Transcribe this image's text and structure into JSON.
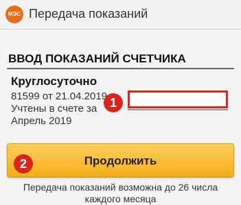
{
  "app": {
    "title": "Передача показаний",
    "logo_text": "МЭС",
    "accent": "#f2ad1a",
    "logo_color": "#e86c1a"
  },
  "section": {
    "title": "ВВОД ПОКАЗАНИЙ СЧЕТЧИКА"
  },
  "meter": {
    "name": "Круглосуточно",
    "last_reading": "81599 от 21.04.2019",
    "accounted_line1": "Учтены в счете за",
    "accounted_line2": "Апрель 2019",
    "input_value": "",
    "input_placeholder": ""
  },
  "badges": {
    "step1": "1",
    "step2": "2",
    "color": "#d9251d"
  },
  "actions": {
    "continue_label": "Продолжить"
  },
  "note": {
    "text": "Передача показаний возможна до 26 числа каждого месяца"
  }
}
